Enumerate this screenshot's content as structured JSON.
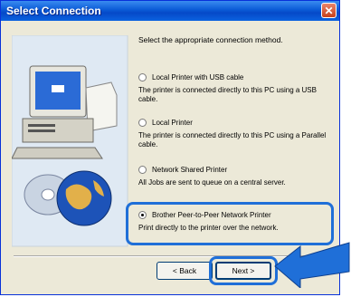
{
  "window": {
    "title": "Select Connection",
    "close_glyph": "✕"
  },
  "dialog": {
    "prompt": "Select the appropriate connection method."
  },
  "options": [
    {
      "label": "Local Printer with USB cable",
      "desc": "The printer is connected directly to this PC using a USB cable."
    },
    {
      "label": "Local Printer",
      "desc": "The printer is connected directly to this PC using a Parallel cable."
    },
    {
      "label": "Network Shared Printer",
      "desc": "All Jobs are sent to queue on a central server."
    },
    {
      "label": "Brother Peer-to-Peer Network Printer",
      "desc": "Print directly to the printer over the network."
    }
  ],
  "buttons": {
    "back_label": "< Back",
    "next_label": "Next >"
  },
  "colors": {
    "highlight": "#1f6fd8",
    "title_bar": "#0a5ad6"
  },
  "icons": {
    "illustration": "computer-globe-illustration",
    "pointer": "blue-pointer-arrow"
  }
}
